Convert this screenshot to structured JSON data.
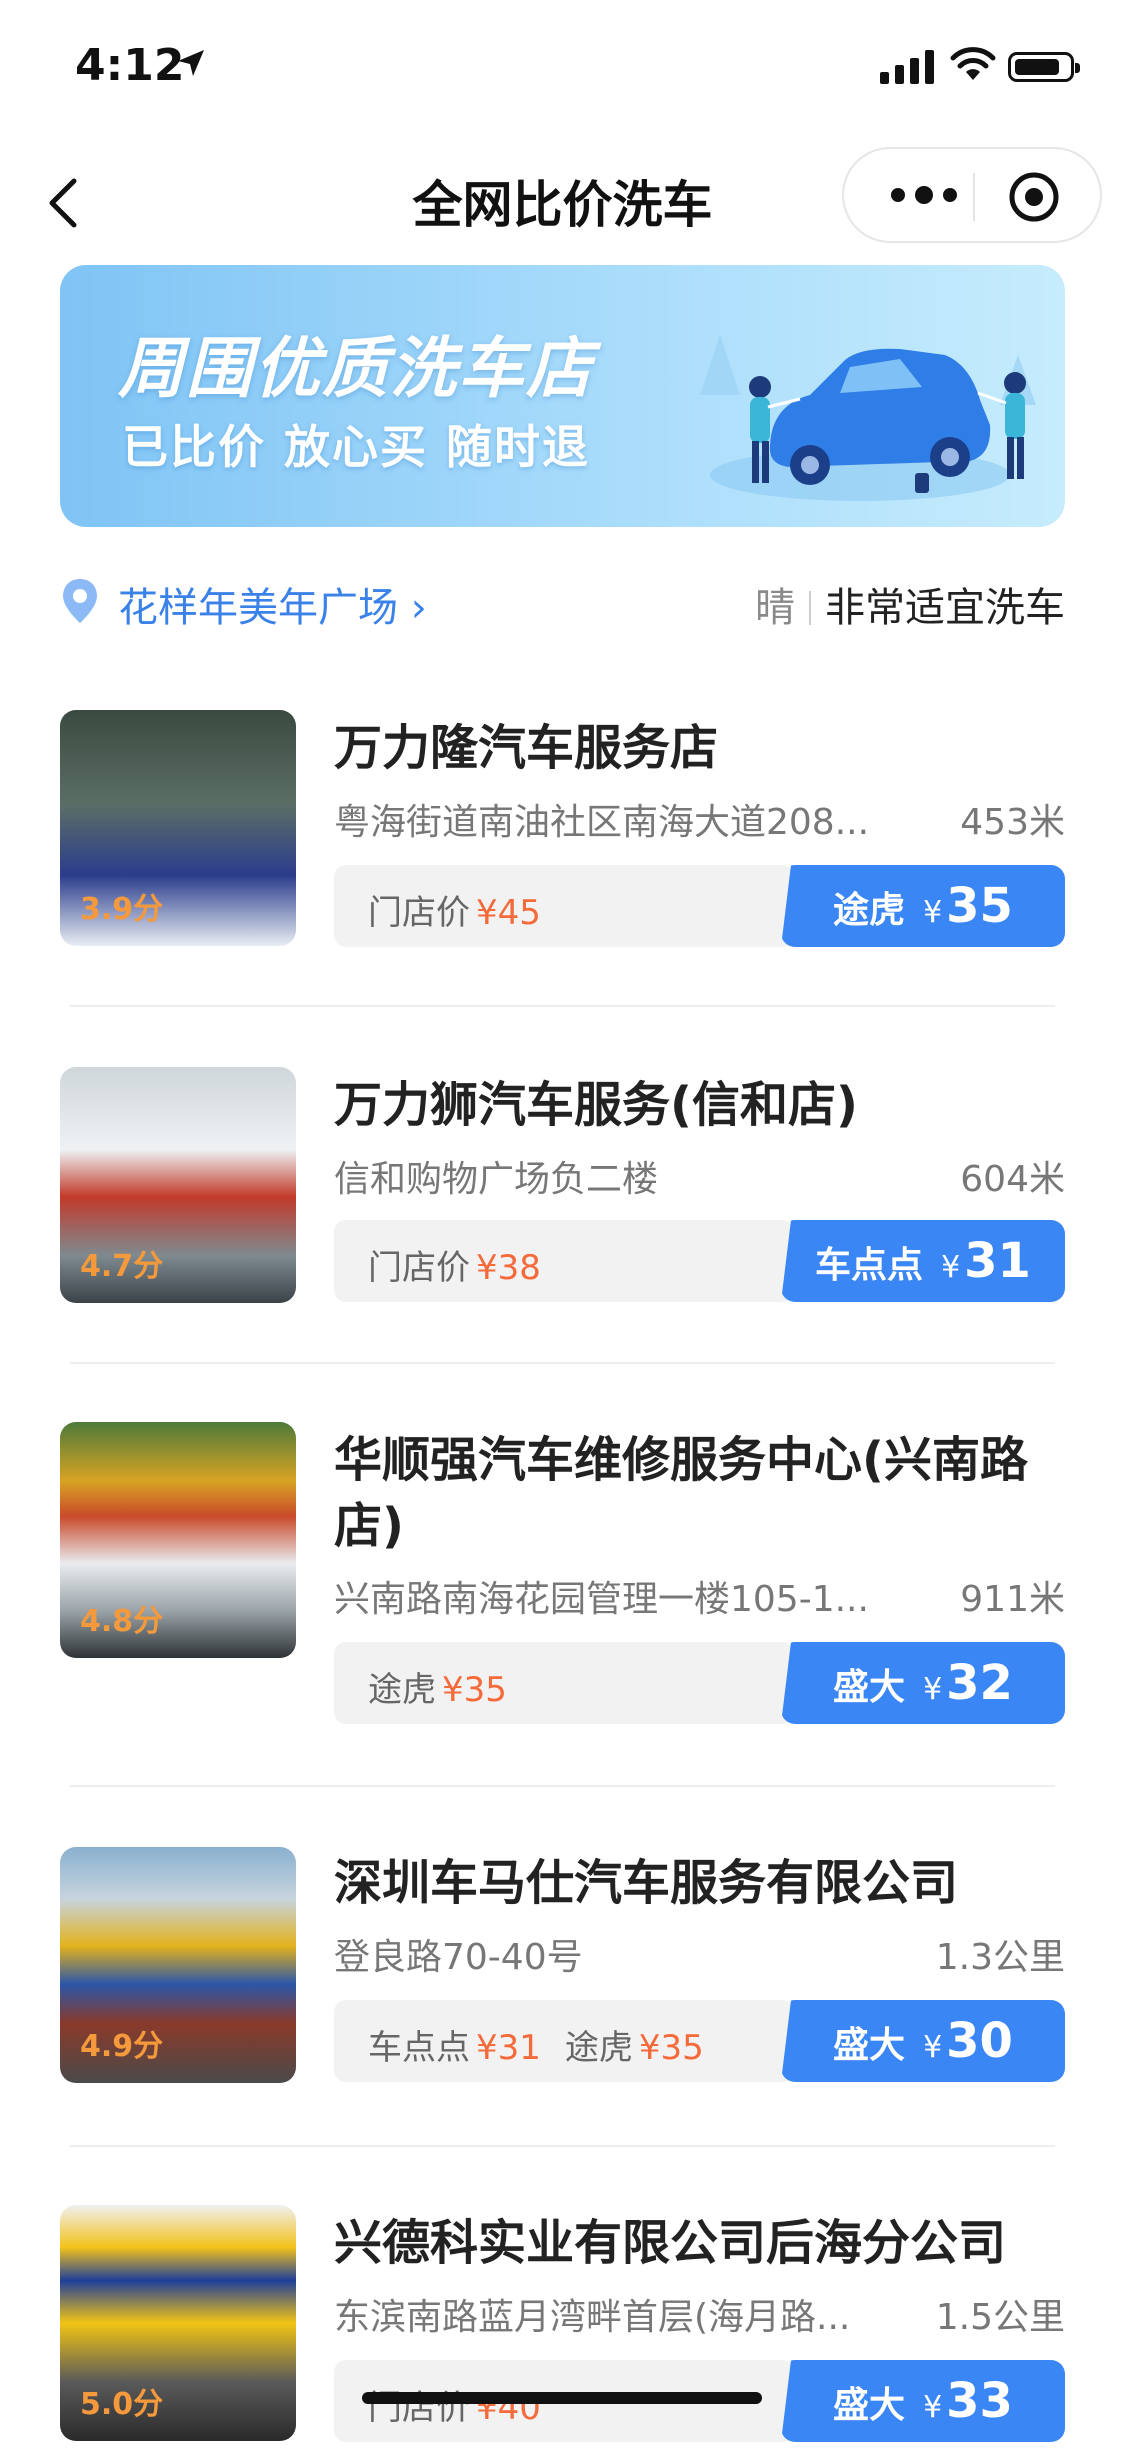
{
  "status": {
    "time": "4:12"
  },
  "nav": {
    "title": "全网比价洗车"
  },
  "banner": {
    "line1": "周围优质洗车店",
    "line2": "已比价  放心买  随时退"
  },
  "location": {
    "name": "花样年美年广场 ›",
    "weather": "晴",
    "tip": "非常适宜洗车"
  },
  "stores": [
    {
      "name": "万力隆汽车服务店",
      "score": "3.9分",
      "address": "粤海街道南油社区南海大道208...",
      "distance": "453米",
      "compare": [
        {
          "label": "门店价",
          "price": "¥45"
        }
      ],
      "platform": "途虎",
      "yen": "¥",
      "price": "35"
    },
    {
      "name": "万力狮汽车服务(信和店)",
      "score": "4.7分",
      "address": "信和购物广场负二楼",
      "distance": "604米",
      "compare": [
        {
          "label": "门店价",
          "price": "¥38"
        }
      ],
      "platform": "车点点",
      "yen": "¥",
      "price": "31"
    },
    {
      "name": "华顺强汽车维修服务中心(兴南路店)",
      "score": "4.8分",
      "address": "兴南路南海花园管理一楼105-1...",
      "distance": "911米",
      "compare": [
        {
          "label": "途虎",
          "price": "¥35"
        }
      ],
      "platform": "盛大",
      "yen": "¥",
      "price": "32"
    },
    {
      "name": "深圳车马仕汽车服务有限公司",
      "score": "4.9分",
      "address": "登良路70-40号",
      "distance": "1.3公里",
      "compare": [
        {
          "label": "车点点",
          "price": "¥31"
        },
        {
          "label": "途虎",
          "price": "¥35"
        }
      ],
      "platform": "盛大",
      "yen": "¥",
      "price": "30"
    },
    {
      "name": "兴德科实业有限公司后海分公司",
      "score": "5.0分",
      "address": "东滨南路蓝月湾畔首层(海月路...",
      "distance": "1.5公里",
      "compare": [
        {
          "label": "门店价",
          "price": "¥40"
        }
      ],
      "platform": "盛大",
      "yen": "¥",
      "price": "33"
    }
  ],
  "colors": {
    "accent": "#3a86f5",
    "price_red": "#f56a3a",
    "score_orange": "#f59a3c",
    "link_blue": "#3b82e8"
  }
}
